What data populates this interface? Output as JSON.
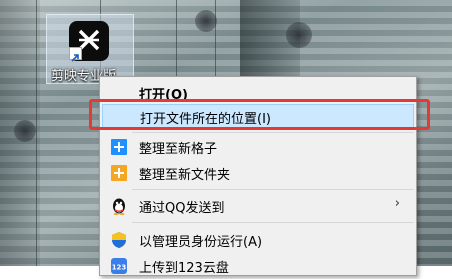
{
  "desktop": {
    "shortcut": {
      "label": "剪映专业版",
      "icon": "capcut-app-icon"
    }
  },
  "context_menu": {
    "items": [
      {
        "label": "打开(O)",
        "bold": true,
        "icon": ""
      },
      {
        "label": "打开文件所在的位置(I)",
        "highlighted": true,
        "icon": ""
      },
      {
        "label": "整理至新格子",
        "icon": "add-cell-icon"
      },
      {
        "label": "整理至新文件夹",
        "icon": "add-folder-icon"
      },
      {
        "label": "通过QQ发送到",
        "icon": "qq-penguin-icon",
        "submenu": true
      },
      {
        "label": "以管理员身份运行(A)",
        "icon": "uac-shield-icon"
      },
      {
        "label": "上传到123云盘",
        "icon": "cloud-123-icon"
      }
    ],
    "submenu_arrow": "›"
  },
  "colors": {
    "menu_bg": "#f0f0f0",
    "highlight_bg": "#cce8ff",
    "highlight_border": "#99d1ff",
    "annotation_red": "#e53935"
  }
}
